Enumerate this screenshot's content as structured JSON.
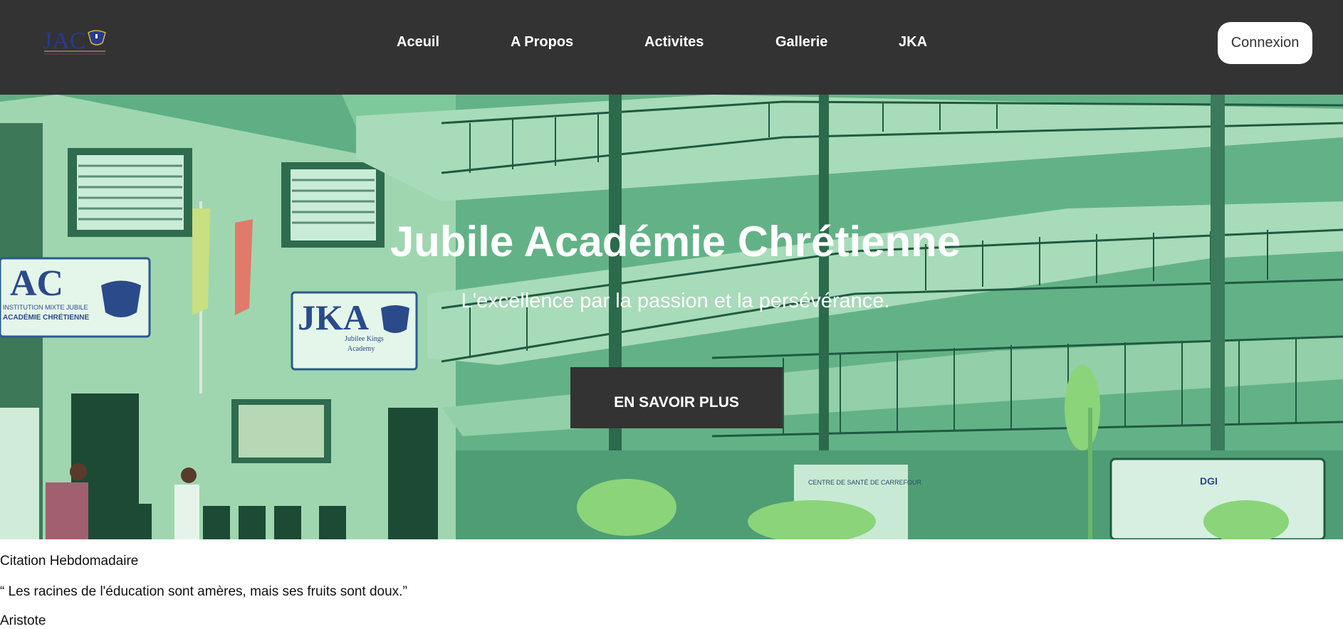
{
  "nav": {
    "logo_text": "JAC",
    "links": [
      "Aceuil",
      "A Propos",
      "Activites",
      "Gallerie",
      "JKA"
    ],
    "login_label": "Connexion"
  },
  "hero": {
    "title": "Jubile Académie Chrétienne",
    "subtitle": "L'excellence par la passion et la persévérance.",
    "cta_label": "EN SAVOIR PLUS",
    "signs": {
      "jac_sign": "AC",
      "jac_sign_line1": "INSTITUTION MIXTE JUBILE",
      "jac_sign_line2": "ACADÉMIE CHRÉTIENNE",
      "jka_sign": "JKA",
      "jka_sign_line1": "Jubilee Kings",
      "jka_sign_line2": "Academy",
      "health_center": "CENTRE DE SANTÉ DE CARREFOUR",
      "dgi": "DGI"
    }
  },
  "quote": {
    "heading": "Citation Hebdomadaire",
    "text": "“ Les racines de l'éducation sont amères, mais ses fruits sont doux.”",
    "author": "Aristote"
  },
  "colors": {
    "navbar_bg": "#333333",
    "hero_tint": "#5fae84",
    "cta_bg": "#333333",
    "text_light": "#ffffff"
  }
}
